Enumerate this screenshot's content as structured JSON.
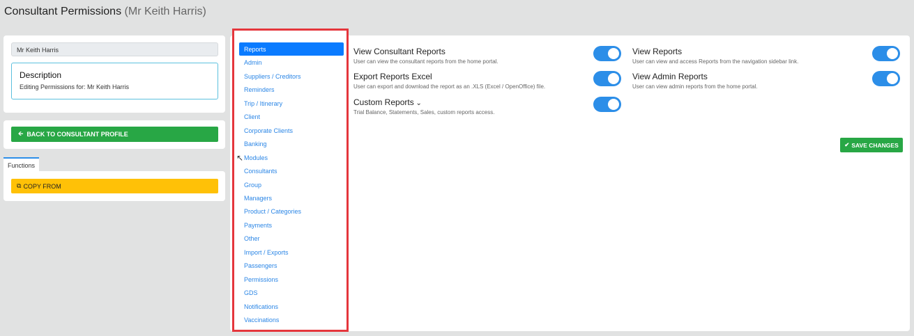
{
  "header": {
    "title": "Consultant Permissions",
    "subtitle": "(Mr Keith Harris)"
  },
  "profile": {
    "name": "Mr Keith Harris",
    "description_title": "Description",
    "description_text": "Editing Permissions for: Mr Keith Harris"
  },
  "back_button": "BACK TO CONSULTANT PROFILE",
  "functions_tab": "Functions",
  "copy_button": "COPY FROM",
  "nav": {
    "items": [
      "Reports",
      "Admin",
      "Suppliers / Creditors",
      "Reminders",
      "Trip / Itinerary",
      "Client",
      "Corporate Clients",
      "Banking",
      "Modules",
      "Consultants",
      "Group",
      "Managers",
      "Product / Categories",
      "Payments",
      "Other",
      "Import / Exports",
      "Passengers",
      "Permissions",
      "GDS",
      "Notifications",
      "Vaccinations"
    ],
    "active": "Reports"
  },
  "permissions": [
    {
      "title": "View Consultant Reports",
      "desc": "User can view the consultant reports from the home portal.",
      "enabled": true
    },
    {
      "title": "Export Reports Excel",
      "desc": "User can export and download the report as an .XLS (Excel / OpenOffice) file.",
      "enabled": true
    },
    {
      "title": "Custom Reports",
      "desc": "Trial Balance, Statements, Sales, custom reports access.",
      "enabled": true
    },
    {
      "title": "View Reports",
      "desc": "User can view and access Reports from the navigation sidebar link.",
      "enabled": true
    },
    {
      "title": "View Admin Reports",
      "desc": "User can view admin reports from the home portal.",
      "enabled": true
    }
  ],
  "save_button": "SAVE CHANGES",
  "colors": {
    "primary": "#0a7bff",
    "success": "#28a745",
    "warning": "#ffc107",
    "toggle": "#2c8ee8",
    "highlight": "#e5363c"
  }
}
